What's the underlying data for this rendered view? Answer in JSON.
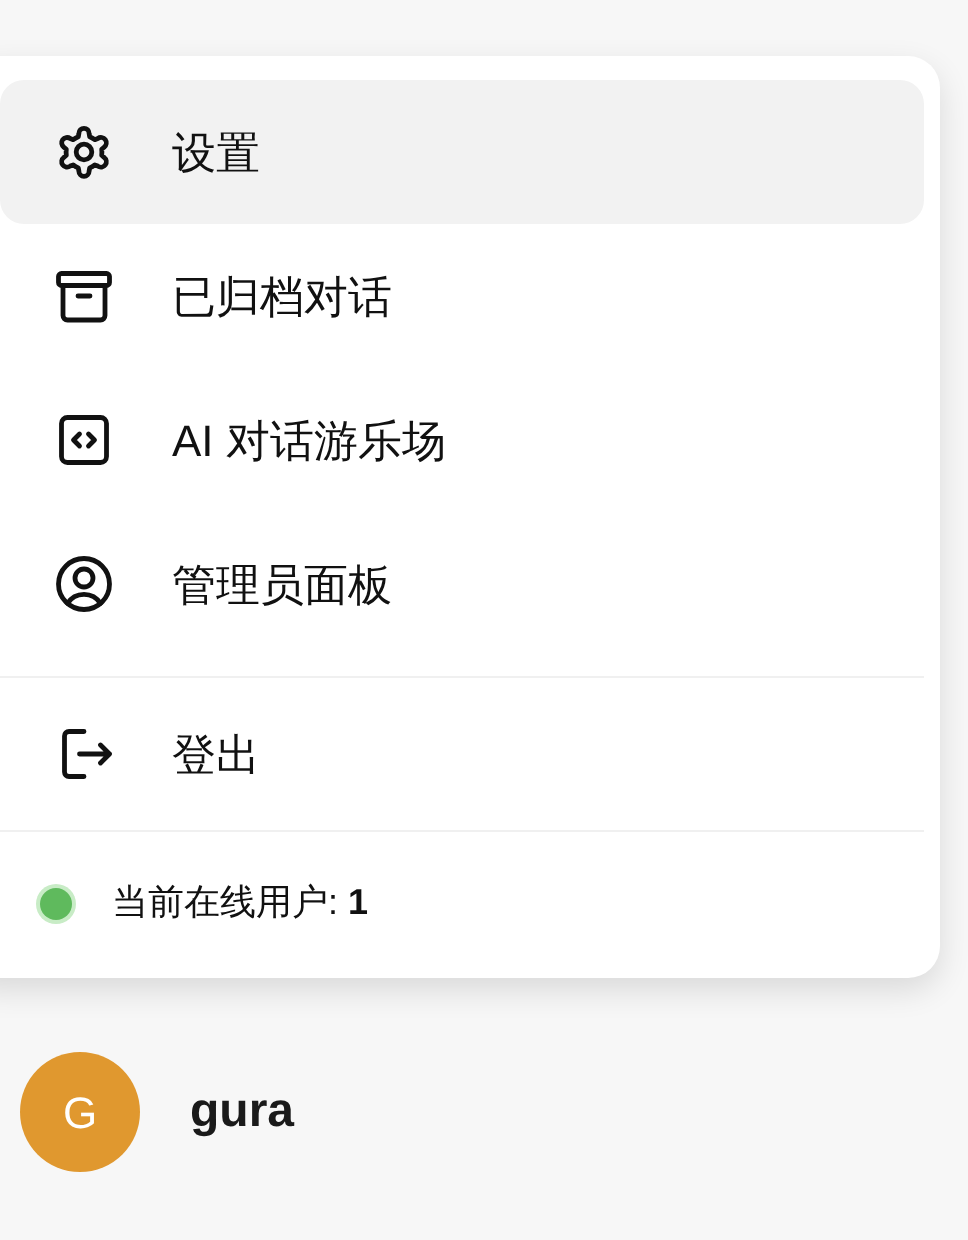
{
  "menu": {
    "sections": [
      {
        "items": [
          {
            "kind": "settings",
            "label": "设置",
            "selected": true
          },
          {
            "kind": "archive",
            "label": "已归档对话",
            "selected": false
          },
          {
            "kind": "code",
            "label": "AI 对话游乐场",
            "selected": false
          },
          {
            "kind": "admin",
            "label": "管理员面板",
            "selected": false
          }
        ]
      },
      {
        "items": [
          {
            "kind": "logout",
            "label": "登出",
            "selected": false
          }
        ]
      }
    ],
    "status": {
      "text": "当前在线用户: **1**",
      "color": "#5fba5d"
    }
  },
  "user": {
    "initial": "G",
    "name": "gura",
    "color": "#e0982f"
  }
}
